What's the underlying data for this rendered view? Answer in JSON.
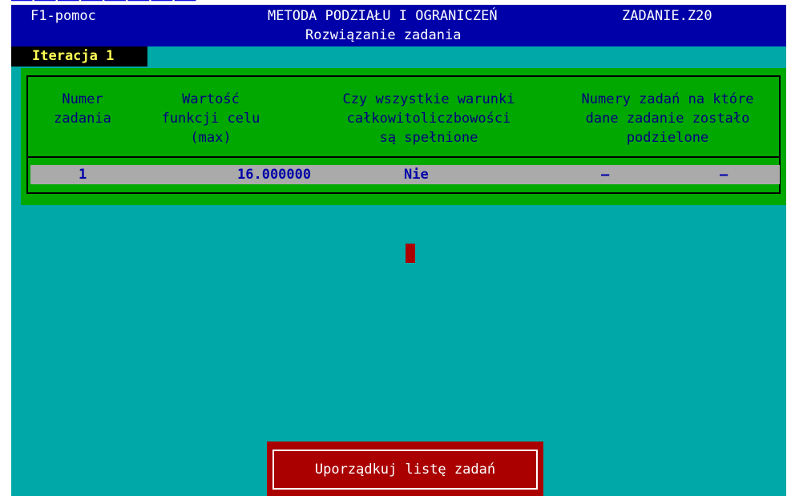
{
  "header": {
    "help": "F1-pomoc",
    "method": "METODA PODZIAŁU I OGRANICZEŃ",
    "task": "ZADANIE.Z20",
    "subtitle": "Rozwiązanie zadania"
  },
  "iteration_label": "Iteracja 1",
  "table": {
    "columns": [
      "Numer\nzadania",
      "Wartość\nfunkcji celu\n(max)",
      "Czy wszystkie warunki\ncałkowitoliczbowości\nsą spełnione",
      "Numery zadań na które\ndane zadanie zostało\npodzielone"
    ],
    "rows": [
      {
        "number": "1",
        "value": "16.000000",
        "integer": "Nie",
        "split_1": "–",
        "split_2": "–"
      }
    ]
  },
  "button": {
    "label": "Uporządkuj listę zadań"
  },
  "colors": {
    "background": "#00a8a8",
    "header": "#0000a8",
    "panel": "#00a800",
    "row": "#aaaaaa",
    "button": "#aa0000",
    "iteration_text": "#ffff55"
  }
}
